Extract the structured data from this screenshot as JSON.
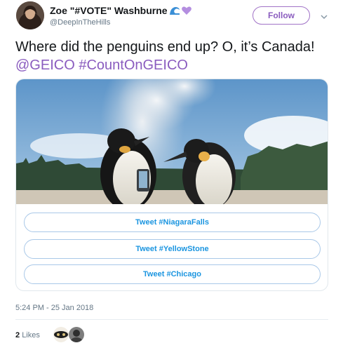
{
  "user": {
    "name": "Zoe \"#VOTE\" Washburne",
    "handle": "@DeepInTheHills",
    "follow_label": "Follow"
  },
  "tweet": {
    "text_plain": "Where did the penguins end up? O, it’s Canada!",
    "mention": "@GEICO",
    "hashtag": "#CountOnGEICO"
  },
  "poll": {
    "options": [
      {
        "label": "Tweet #NiagaraFalls"
      },
      {
        "label": "Tweet #YellowStone"
      },
      {
        "label": "Tweet #Chicago"
      }
    ]
  },
  "meta": {
    "timestamp": "5:24 PM - 25 Jan 2018",
    "likes_count": "2",
    "likes_label": "Likes"
  },
  "colors": {
    "accent": "#8a5cbf",
    "link_blue": "#1b95e0",
    "muted": "#657786"
  }
}
